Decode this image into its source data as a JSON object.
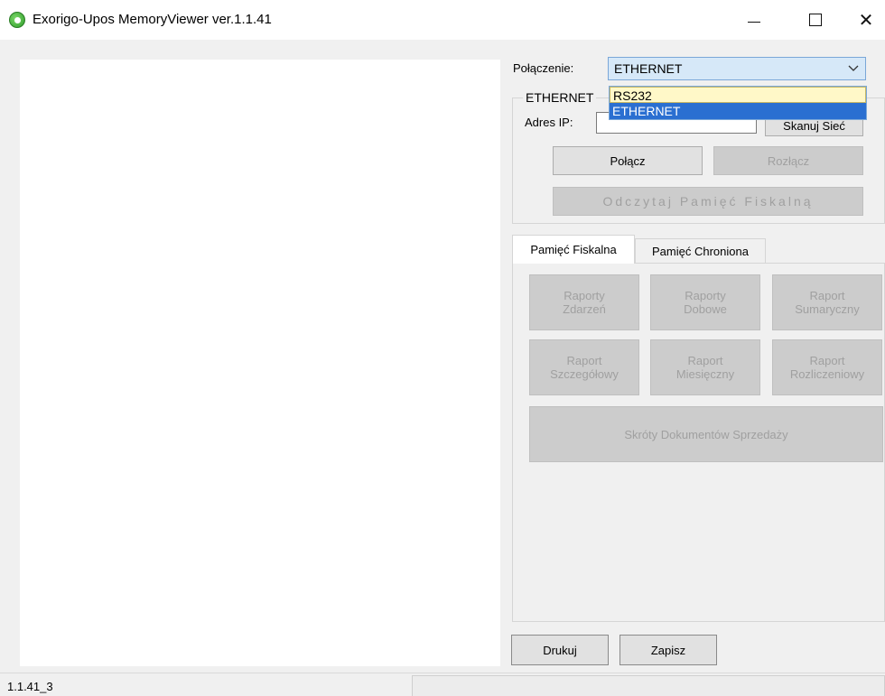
{
  "window": {
    "title": "Exorigo-Upos MemoryViewer ver.1.1.41",
    "minimize_glyph": "—",
    "close_glyph": "✕"
  },
  "connection": {
    "label": "Połączenie:",
    "selected": "ETHERNET",
    "options": [
      "RS232",
      "ETHERNET"
    ],
    "highlighted_option": "ETHERNET"
  },
  "ethernet_group": {
    "title": "ETHERNET",
    "ip_label": "Adres IP:",
    "ip_value": "",
    "scan_button": "Skanuj Sieć",
    "connect_button": "Połącz",
    "disconnect_button": "Rozłącz",
    "read_button": "Odczytaj Pamięć Fiskalną"
  },
  "tabs": [
    {
      "label": "Pamięć Fiskalna",
      "active": true
    },
    {
      "label": "Pamięć Chroniona",
      "active": false
    }
  ],
  "fiscal_panel": {
    "buttons": [
      {
        "line1": "Raporty",
        "line2": "Zdarzeń"
      },
      {
        "line1": "Raporty",
        "line2": "Dobowe"
      },
      {
        "line1": "Raport",
        "line2": "Sumaryczny"
      },
      {
        "line1": "Raport",
        "line2": "Szczegółowy"
      },
      {
        "line1": "Raport",
        "line2": "Miesięczny"
      },
      {
        "line1": "Raport",
        "line2": "Rozliczeniowy"
      }
    ],
    "summary_button": "Skróty Dokumentów Sprzedaży"
  },
  "actions": {
    "print_button": "Drukuj",
    "save_button": "Zapisz"
  },
  "status": {
    "version": "1.1.41_3"
  },
  "colors": {
    "combo_bg": "#d6e8f8",
    "dropdown_hover": "#fff8c8",
    "dropdown_selected": "#2a6fd1",
    "disabled_button": "#cccccc"
  },
  "icons": {
    "app": "app-icon",
    "combo": "chevron-down-icon"
  }
}
